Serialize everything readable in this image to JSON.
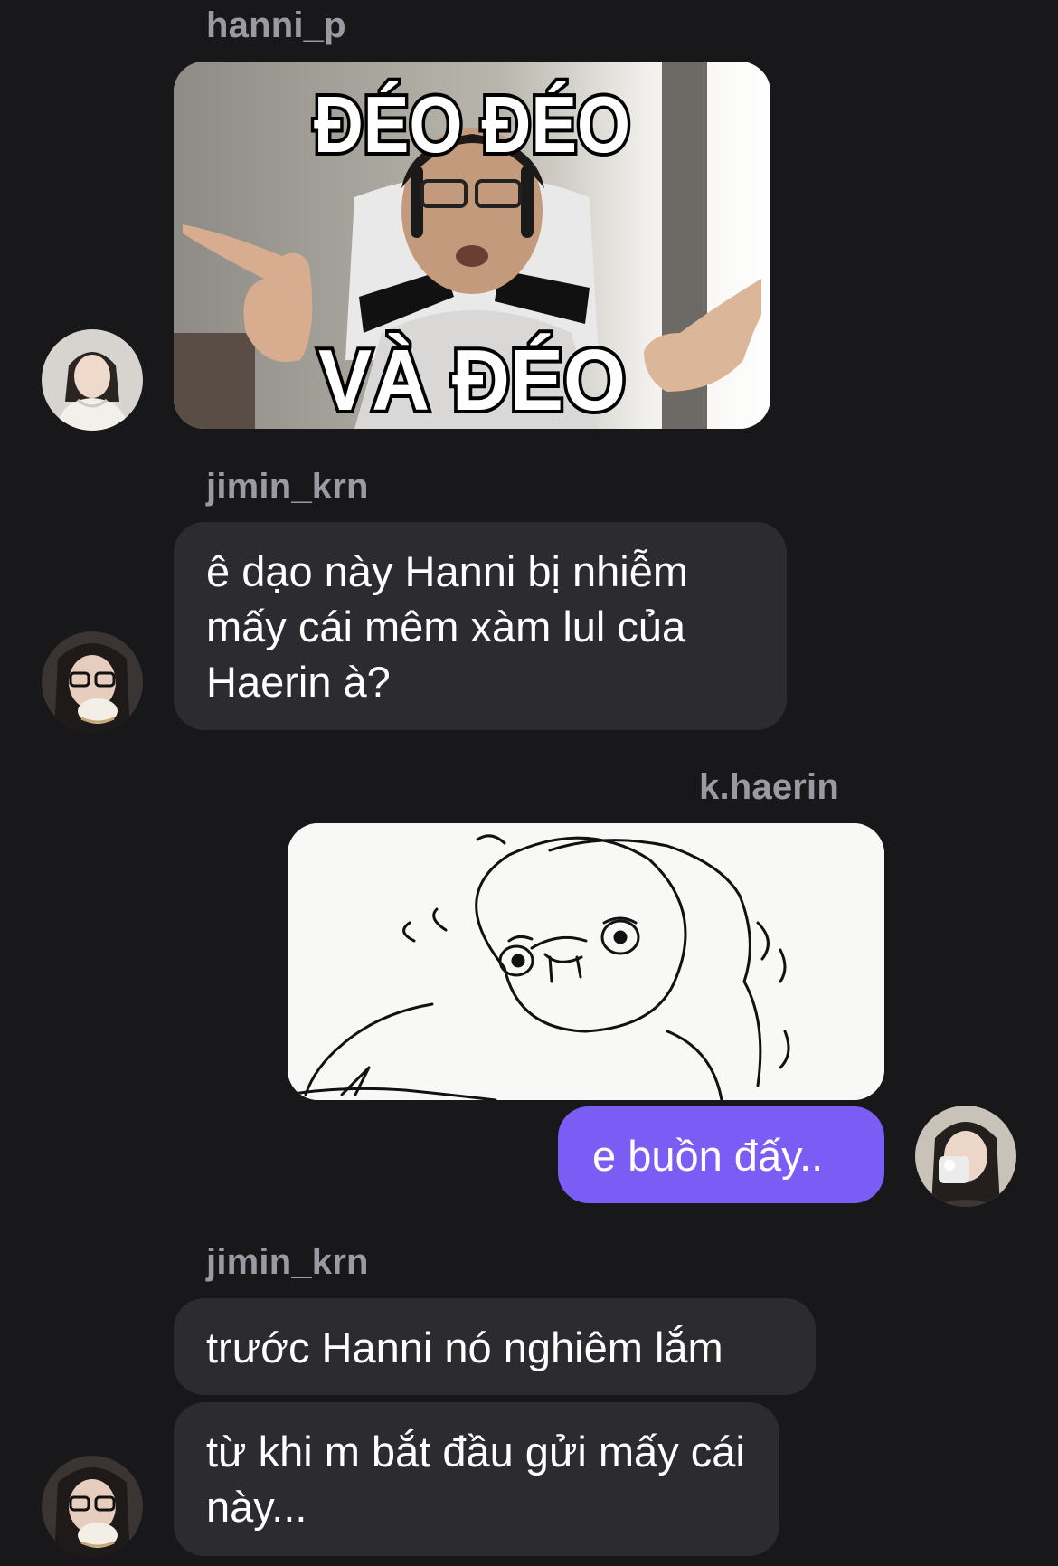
{
  "messages": [
    {
      "sender": "hanni_p",
      "type": "image",
      "meme_top": "ĐÉO ĐÉO",
      "meme_bottom": "VÀ ĐÉO"
    },
    {
      "sender": "jimin_krn",
      "type": "text",
      "text": "ê dạo này Hanni bị nhiễm mấy cái mêm xàm lul của Haerin à?"
    },
    {
      "sender": "k.haerin",
      "type": "image_and_text",
      "text": "e buồn đấy.."
    },
    {
      "sender": "jimin_krn",
      "type": "text_group",
      "texts": [
        "trước Hanni nó nghiêm lắm",
        "từ khi m bắt đầu gửi mấy cái này..."
      ]
    }
  ],
  "colors": {
    "background": "#18181b",
    "bubble_other": "#2b2b30",
    "bubble_mine": "#7b5cf5",
    "username": "#9a9aa2"
  },
  "icons": [
    "avatar-hanni",
    "avatar-jimin",
    "avatar-haerin"
  ]
}
